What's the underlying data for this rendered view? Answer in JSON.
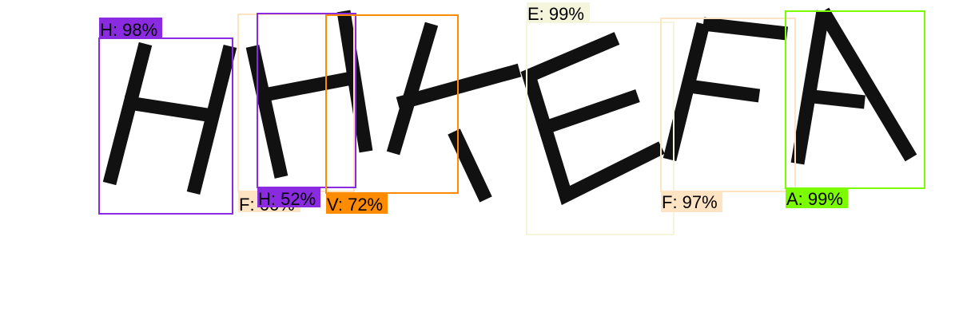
{
  "detections": [
    {
      "label": "H: 98%",
      "color": "#8a2be2"
    },
    {
      "label": "F: 66%",
      "color": "#ffe4c4"
    },
    {
      "label": "H: 52%",
      "color": "#8a2be2"
    },
    {
      "label": "V: 72%",
      "color": "#ff8c00"
    },
    {
      "label": "E: 99%",
      "color": "#f5f5dc"
    },
    {
      "label": "F: 97%",
      "color": "#ffe4c4"
    },
    {
      "label": "A: 99%",
      "color": "#7cfc00"
    }
  ]
}
